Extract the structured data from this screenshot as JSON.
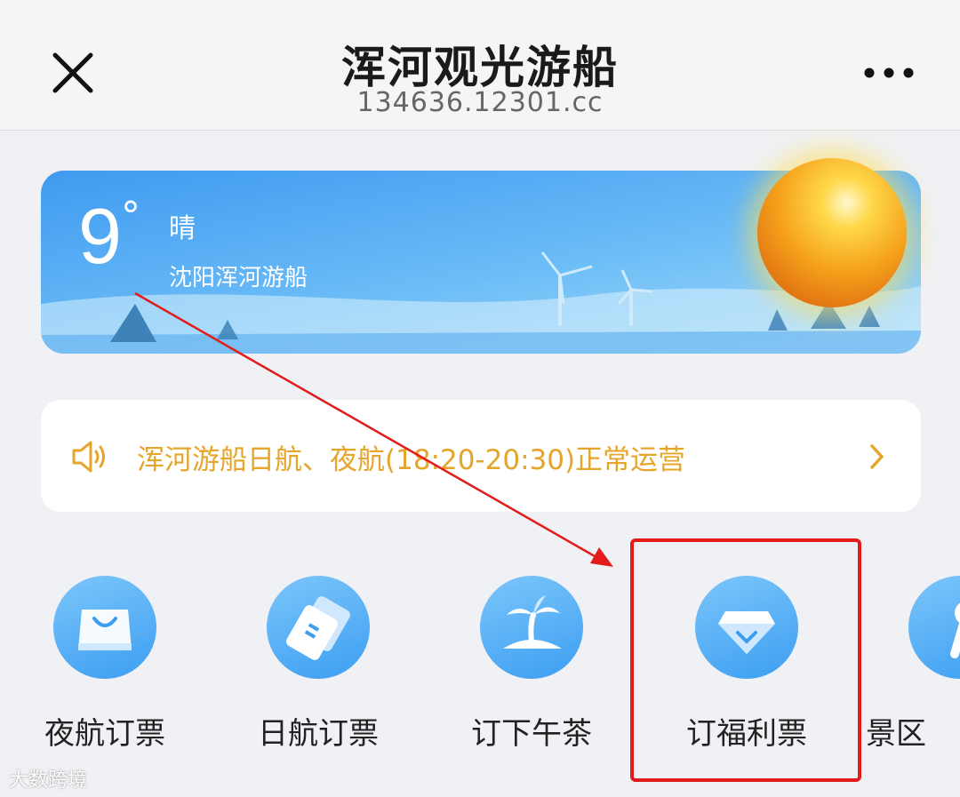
{
  "header": {
    "title": "浑河观光游船",
    "subtitle": "134636.12301.cc",
    "close_icon": "close-icon",
    "more_icon": "more-icon"
  },
  "weather": {
    "temperature": "9",
    "degree_symbol": "°",
    "condition": "晴",
    "location": "沈阳浑河游船",
    "sun_icon": "sun-icon"
  },
  "notice": {
    "text": "浑河游船日航、夜航(18:20-20:30)正常运营",
    "icon": "speaker-icon",
    "accent_color": "#e5a52b"
  },
  "features": [
    {
      "label": "夜航订票",
      "icon": "shopping-bag-icon"
    },
    {
      "label": "日航订票",
      "icon": "ticket-icon"
    },
    {
      "label": "订下午茶",
      "icon": "palm-island-icon"
    },
    {
      "label": "订福利票",
      "icon": "diamond-icon"
    },
    {
      "label": "景区",
      "icon": "tool-icon"
    }
  ],
  "annotation": {
    "color": "#e41b1b"
  },
  "watermark": "大数跨境"
}
